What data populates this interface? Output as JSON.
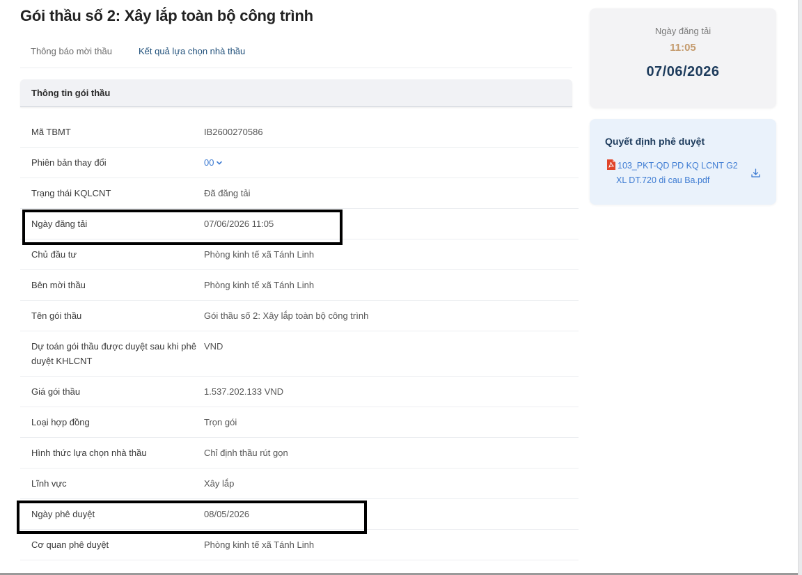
{
  "title": "Gói thầu số 2: Xây lắp toàn bộ công trình",
  "tabs": [
    {
      "label": "Thông báo mời thầu",
      "active": false
    },
    {
      "label": "Kết quả lựa chọn nhà thầu",
      "active": true
    }
  ],
  "section": {
    "title": "Thông tin gói thầu"
  },
  "rows": [
    {
      "label": "Mã TBMT",
      "value": "IB2600270586"
    },
    {
      "label": "Phiên bản thay đổi",
      "value": "00"
    },
    {
      "label": "Trạng thái KQLCNT",
      "value": "Đã đăng tải"
    },
    {
      "label": "Ngày đăng tải",
      "value": "07/06/2026 11:05"
    },
    {
      "label": "Chủ đầu tư",
      "value": "Phòng kinh tế xã Tánh Linh"
    },
    {
      "label": "Bên mời thầu",
      "value": "Phòng kinh tế xã Tánh Linh"
    },
    {
      "label": "Tên gói thầu",
      "value": "Gói thầu số 2: Xây lắp toàn bộ công trình"
    },
    {
      "label": "Dự toán gói thầu được duyệt sau khi phê duyệt KHLCNT",
      "value": "VND"
    },
    {
      "label": "Giá gói thầu",
      "value": "1.537.202.133 VND"
    },
    {
      "label": "Loại hợp đồng",
      "value": "Trọn gói"
    },
    {
      "label": "Hình thức lựa chọn nhà thầu",
      "value": "Chỉ định thầu rút gọn"
    },
    {
      "label": "Lĩnh vực",
      "value": "Xây lắp"
    },
    {
      "label": "Ngày phê duyệt",
      "value": "08/05/2026"
    },
    {
      "label": "Cơ quan phê duyệt",
      "value": "Phòng kinh tế xã Tánh Linh"
    }
  ],
  "sidebar": {
    "posted_label": "Ngày đăng tải",
    "posted_time": "11:05",
    "posted_date": "07/06/2026",
    "decision_title": "Quyết định phê duyệt",
    "file_name_line1": "103_PKT-QD PD KQ LCNT G2",
    "file_name_line2": "XL DT.720 di cau Ba.pdf"
  },
  "colors": {
    "link": "#3d7bd2",
    "heading_navy": "#1d3b5c",
    "time_accent": "#c49a6c",
    "pdf_red": "#e0452a"
  },
  "icons": [
    "chevron-down-icon",
    "pdf-file-icon",
    "download-icon"
  ]
}
